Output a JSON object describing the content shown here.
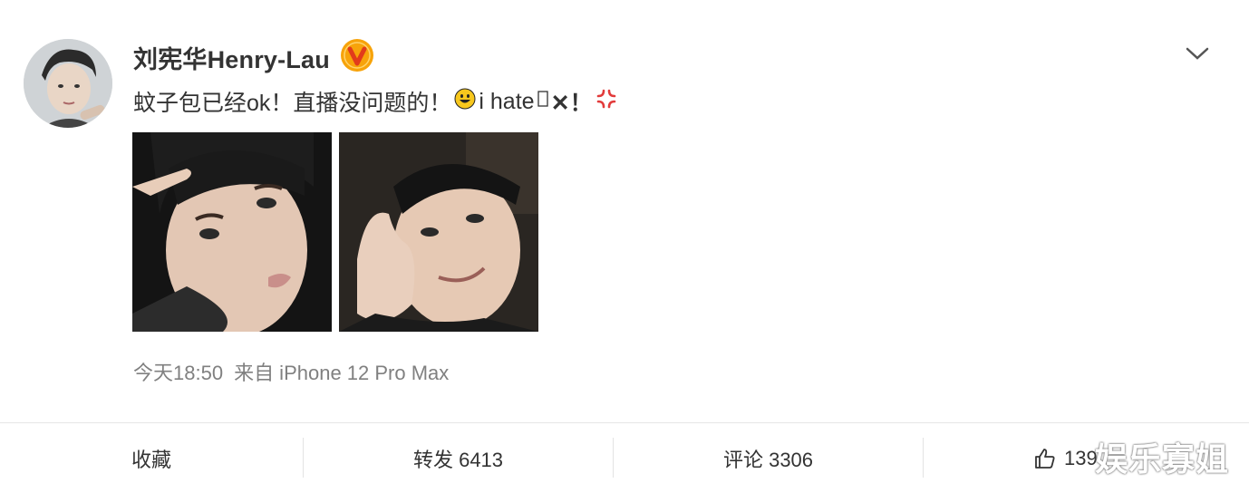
{
  "post": {
    "author": "刘宪华Henry-Lau",
    "verified_icon": "verified-v-badge-icon",
    "content_prefix": "蚊子包已经ok！直播没问题的！",
    "content_suffix": "i hate",
    "content_tail": "✕！",
    "timestamp": "今天18:50",
    "source": "来自 iPhone 12 Pro Max",
    "images": [
      "photo-1",
      "photo-2"
    ]
  },
  "actions": {
    "favorite_label": "收藏",
    "repost_label": "转发 6413",
    "comment_label": "评论 3306",
    "like_label": "139"
  },
  "watermark": "娱乐寡姐",
  "colors": {
    "verified": "#f7a30a",
    "text": "#333333",
    "meta": "#808080"
  }
}
